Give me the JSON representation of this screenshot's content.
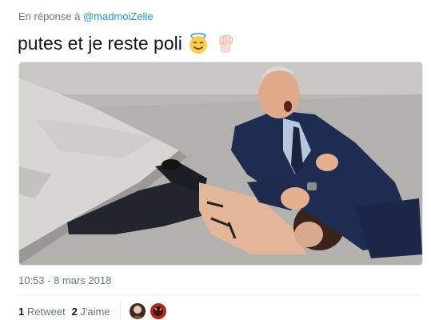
{
  "reply": {
    "prefix": "En réponse à ",
    "mention": "@madmoiZelle"
  },
  "tweet": {
    "text": "putes et je reste poli",
    "emojis": [
      "angel-face-emoji",
      "raised-fist-emoji"
    ]
  },
  "media": {
    "icon": "photo"
  },
  "timestamp": "10:53 - 8 mars 2018",
  "stats": {
    "retweets_count": "1",
    "retweets_label": "Retweet",
    "likes_count": "2",
    "likes_label": "J'aime",
    "liker_avatars": [
      "avatar-1",
      "avatar-2"
    ]
  },
  "colors": {
    "link": "#1b95e0",
    "secondary_text": "#657786",
    "primary_text": "#14171a",
    "divider": "#e6ecf0"
  }
}
